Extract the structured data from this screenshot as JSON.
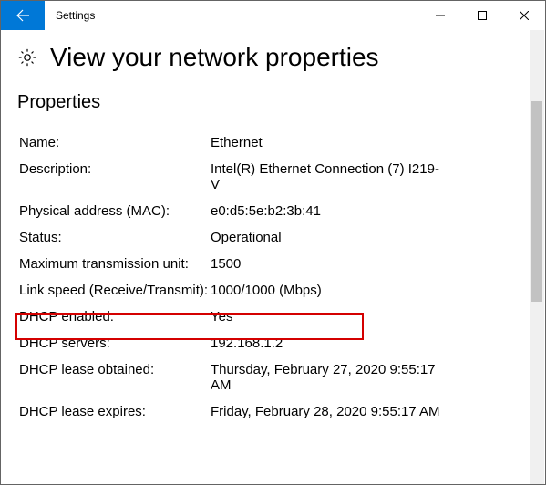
{
  "window": {
    "title": "Settings"
  },
  "page": {
    "heading": "View your network properties",
    "section": "Properties"
  },
  "props": {
    "name_label": "Name:",
    "name_value": "Ethernet",
    "desc_label": "Description:",
    "desc_value": "Intel(R) Ethernet Connection (7) I219-V",
    "mac_label": "Physical address (MAC):",
    "mac_value": "e0:d5:5e:b2:3b:41",
    "status_label": "Status:",
    "status_value": "Operational",
    "mtu_label": "Maximum transmission unit:",
    "mtu_value": "1500",
    "link_label": "Link speed (Receive/Transmit):",
    "link_value": "1000/1000 (Mbps)",
    "dhcp_en_label": "DHCP enabled:",
    "dhcp_en_value": "Yes",
    "dhcp_srv_label": "DHCP servers:",
    "dhcp_srv_value": "192.168.1.2",
    "dhcp_obt_label": "DHCP lease obtained:",
    "dhcp_obt_value": "Thursday, February 27, 2020 9:55:17 AM",
    "dhcp_exp_label": "DHCP lease expires:",
    "dhcp_exp_value": "Friday, February 28, 2020 9:55:17 AM"
  }
}
